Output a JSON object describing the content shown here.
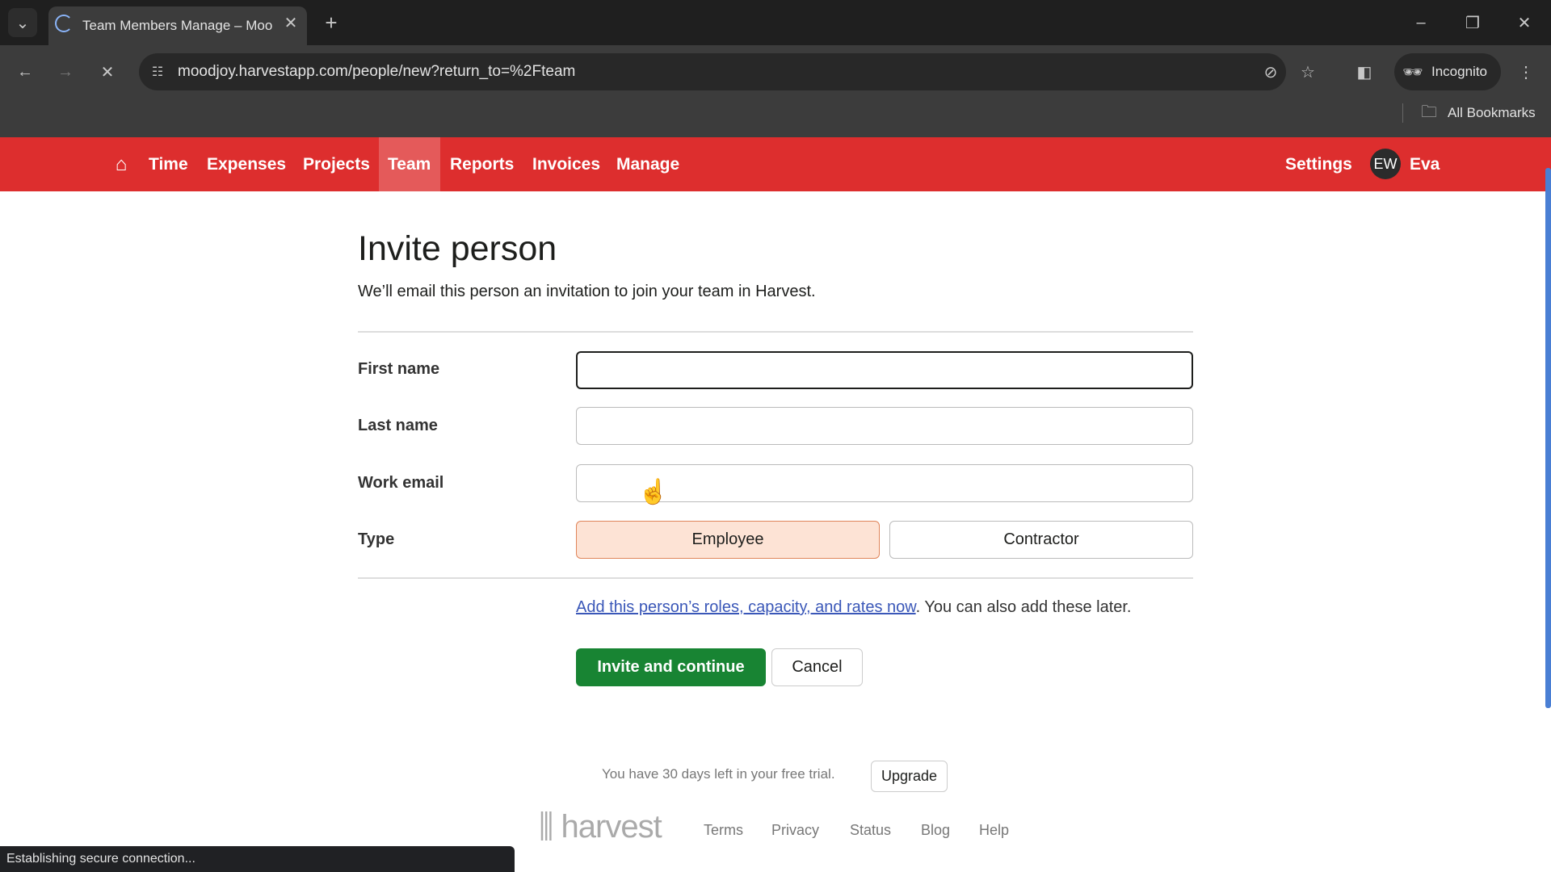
{
  "browser": {
    "tab_title": "Team Members Manage – Moo",
    "url": "moodjoy.harvestapp.com/people/new?return_to=%2Fteam",
    "incognito_label": "Incognito",
    "bookmarks_label": "All Bookmarks",
    "status": "Establishing secure connection..."
  },
  "nav": {
    "items": [
      "Time",
      "Expenses",
      "Projects",
      "Team",
      "Reports",
      "Invoices",
      "Manage"
    ],
    "active": "Team",
    "settings": "Settings",
    "avatar_initials": "EW",
    "user": "Eva",
    "color": "#dd2e2e"
  },
  "page": {
    "title": "Invite person",
    "subtitle": "We’ll email this person an invitation to join your team in Harvest.",
    "fields": [
      {
        "label": "First name",
        "value": ""
      },
      {
        "label": "Last name",
        "value": ""
      },
      {
        "label": "Work email",
        "value": ""
      }
    ],
    "type_label": "Type",
    "type_options": [
      "Employee",
      "Contractor"
    ],
    "type_selected": "Employee",
    "link_text": "Add this person’s roles, capacity, and rates now",
    "link_suffix": ". You can also add these later.",
    "invite_button": "Invite and continue",
    "cancel_button": "Cancel"
  },
  "footer": {
    "trial_text": "You have 30 days left in your free trial.",
    "upgrade": "Upgrade",
    "logo": "harvest",
    "links": [
      "Terms",
      "Privacy",
      "Status",
      "Blog",
      "Help"
    ]
  }
}
